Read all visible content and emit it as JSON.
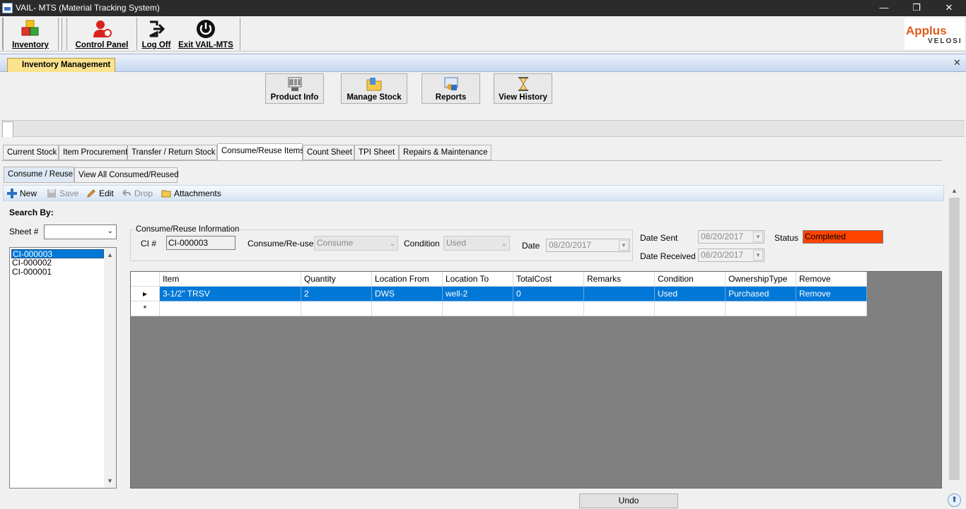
{
  "window": {
    "title": "VAIL- MTS (Material Tracking System)",
    "controls": {
      "minimize": "—",
      "restore": "❐",
      "close": "✕"
    }
  },
  "toolbar": {
    "inventory": "Inventory",
    "control_panel": "Control Panel",
    "log_off": "Log Off",
    "exit": "Exit VAIL-MTS"
  },
  "logo": {
    "text": "Applus",
    "sub": "VELOSI"
  },
  "module": {
    "tab": "Inventory Management",
    "close": "✕"
  },
  "big_buttons": {
    "product_info": "Product Info",
    "manage_stock": "Manage Stock",
    "reports": "Reports",
    "view_history": "View History"
  },
  "tabs": [
    "Current Stock",
    "Item Procurement",
    "Transfer / Return Stock",
    "Consume/Reuse Items",
    "Count Sheet",
    "TPI Sheet",
    "Repairs & Maintenance"
  ],
  "selected_tab": "Consume/Reuse Items",
  "subtabs": [
    "Consume / Reuse",
    "View All Consumed/Reused"
  ],
  "commands": {
    "new": "New",
    "save": "Save",
    "edit": "Edit",
    "drop": "Drop",
    "attachments": "Attachments"
  },
  "search": {
    "title": "Search By:",
    "sheet_label": "Sheet #",
    "sheet_value": "",
    "items": [
      "CI-000003",
      "CI-000002",
      "CI-000001"
    ],
    "selected": "CI-000003"
  },
  "info": {
    "group_label": "Consume/Reuse Information",
    "ci_label": "CI #",
    "ci_value": "CI-000003",
    "consume_label": "Consume/Re-use",
    "consume_value": "Consume",
    "condition_label": "Condition",
    "condition_value": "Used",
    "date_label": "Date",
    "date_value": "08/20/2017",
    "date_sent_label": "Date Sent",
    "date_sent_value": "08/20/2017",
    "date_received_label": "Date Received",
    "date_received_value": "08/20/2017",
    "status_label": "Status",
    "status_value": "Completed",
    "status_color": "#ff4400"
  },
  "grid": {
    "columns": [
      "Item",
      "Quantity",
      "Location From",
      "Location To",
      "TotalCost",
      "Remarks",
      "Condition",
      "OwnershipType",
      "Remove"
    ],
    "rows": [
      [
        "3-1/2\" TRSV",
        "2",
        "DWS",
        "well-2",
        "0",
        "",
        "Used",
        "Purchased",
        "Remove"
      ]
    ],
    "row_marker": "▸",
    "new_row_marker": "*"
  },
  "footer": {
    "undo": "Undo",
    "up": "⬆"
  }
}
